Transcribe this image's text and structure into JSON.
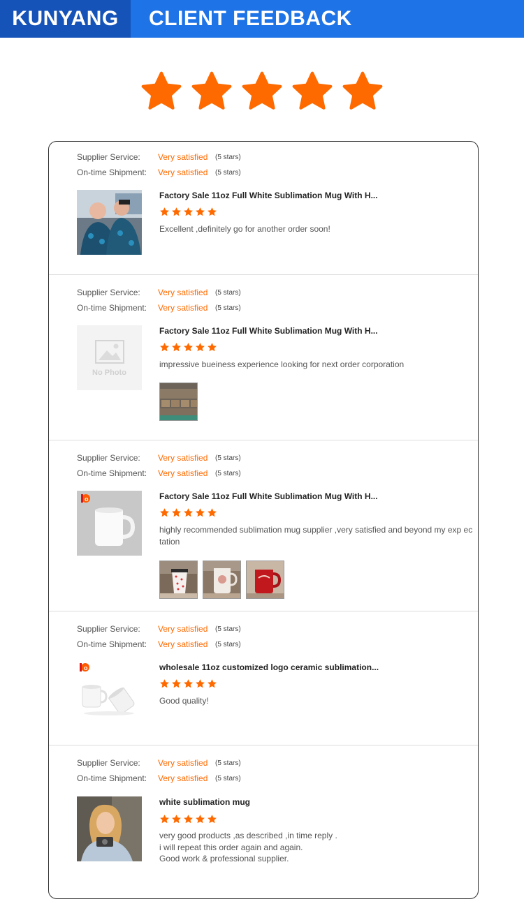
{
  "header": {
    "brand": "KUNYANG",
    "title": "CLIENT FEEDBACK"
  },
  "overall_rating": {
    "stars": 5,
    "max": 5
  },
  "colors": {
    "accent": "#ff6a00",
    "banner_dark": "#1553b8",
    "banner_light": "#1e74e6"
  },
  "reviews": [
    {
      "service_label": "Supplier Service:",
      "service_value": "Very satisfied",
      "service_count": "(5 stars)",
      "shipment_label": "On-time Shipment:",
      "shipment_value": "Very satisfied",
      "shipment_count": "(5 stars)",
      "product": "Factory Sale 11oz Full White Sublimation Mug With H...",
      "rating": 5,
      "comment": "Excellent ,definitely go for another order soon!",
      "thumb": "customer-photo"
    },
    {
      "service_label": "Supplier Service:",
      "service_value": "Very satisfied",
      "service_count": "(5 stars)",
      "shipment_label": "On-time Shipment:",
      "shipment_value": "Very satisfied",
      "shipment_count": "(5 stars)",
      "product": "Factory Sale 11oz Full White Sublimation Mug With H...",
      "rating": 5,
      "comment": "impressive bueiness experience looking for next order corporation",
      "thumb": "no-photo",
      "no_photo_text": "No Photo",
      "photos": [
        "boxes-photo"
      ]
    },
    {
      "service_label": "Supplier Service:",
      "service_value": "Very satisfied",
      "service_count": "(5 stars)",
      "shipment_label": "On-time Shipment:",
      "shipment_value": "Very satisfied",
      "shipment_count": "(5 stars)",
      "product": "Factory Sale 11oz Full White Sublimation Mug With H...",
      "rating": 5,
      "comment": "highly recommended sublimation mug supplier ,very satisfied and beyond my exp ectation",
      "thumb": "white-mug",
      "photos": [
        "dotted-mug-photo",
        "printed-mug-photo",
        "red-mug-photo"
      ]
    },
    {
      "service_label": "Supplier Service:",
      "service_value": "Very satisfied",
      "service_count": "(5 stars)",
      "shipment_label": "On-time Shipment:",
      "shipment_value": "Very satisfied",
      "shipment_count": "(5 stars)",
      "product": "wholesale 11oz customized logo ceramic sublimation...",
      "rating": 5,
      "comment": "Good quality!",
      "thumb": "two-mugs"
    },
    {
      "service_label": "Supplier Service:",
      "service_value": "Very satisfied",
      "service_count": "(5 stars)",
      "shipment_label": "On-time Shipment:",
      "shipment_value": "Very satisfied",
      "shipment_count": "(5 stars)",
      "product": "white sublimation mug",
      "rating": 5,
      "comment_lines": [
        "very good products ,as described ,in time reply .",
        "i will repeat this order again and again.",
        "Good work & professional supplier."
      ],
      "thumb": "customer-photo-woman"
    }
  ]
}
